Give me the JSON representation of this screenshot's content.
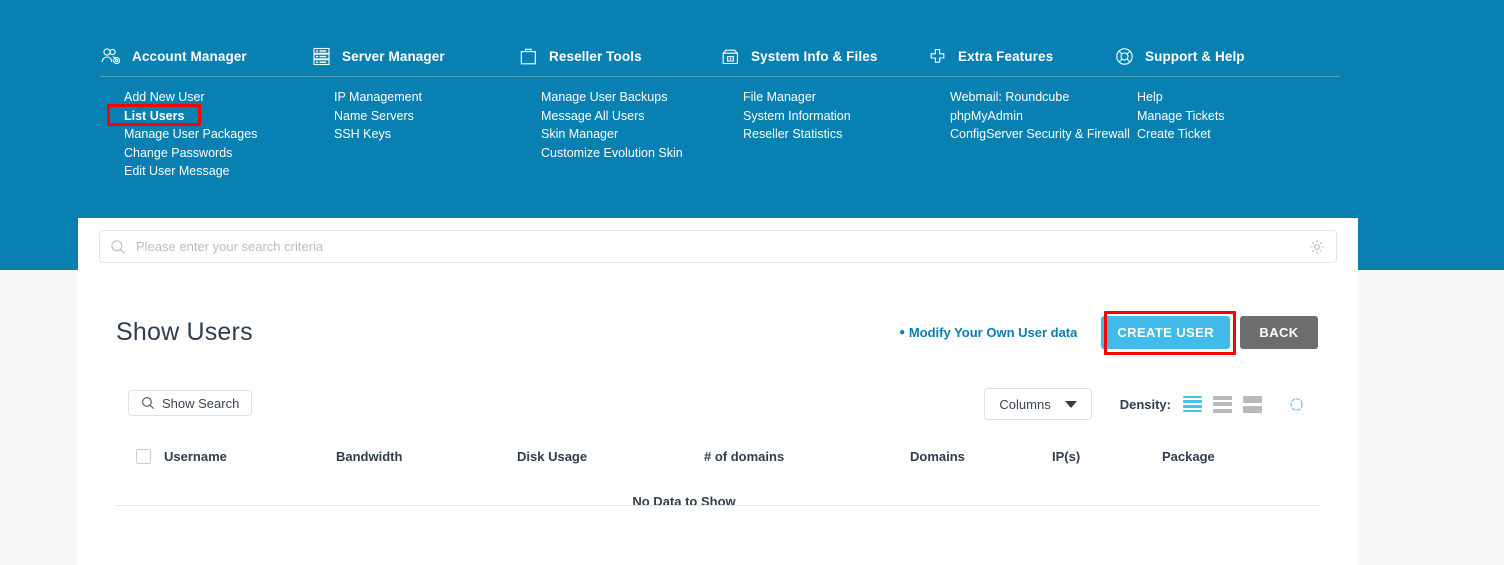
{
  "theme": {
    "header_bg": "#0880b1",
    "page_bg": "#f7f8f8",
    "accent": "#42bbea",
    "link": "#0a7fb0",
    "highlight": "#ff0000",
    "back_button_bg": "#6d6d6d"
  },
  "nav": {
    "columns": [
      {
        "title": "Account Manager",
        "icon": "users-gear-icon",
        "links": [
          {
            "label": "Add New User",
            "highlighted": false
          },
          {
            "label": "List Users",
            "highlighted": true
          },
          {
            "label": "Manage User Packages",
            "highlighted": false
          },
          {
            "label": "Change Passwords",
            "highlighted": false
          },
          {
            "label": "Edit User Message",
            "highlighted": false
          }
        ]
      },
      {
        "title": "Server Manager",
        "icon": "server-rack-icon",
        "links": [
          {
            "label": "IP Management",
            "highlighted": false
          },
          {
            "label": "Name Servers",
            "highlighted": false
          },
          {
            "label": "SSH Keys",
            "highlighted": false
          }
        ]
      },
      {
        "title": "Reseller Tools",
        "icon": "briefcase-icon",
        "links": [
          {
            "label": "Manage User Backups",
            "highlighted": false
          },
          {
            "label": "Message All Users",
            "highlighted": false
          },
          {
            "label": "Skin Manager",
            "highlighted": false
          },
          {
            "label": "Customize Evolution Skin",
            "highlighted": false
          }
        ]
      },
      {
        "title": "System Info & Files",
        "icon": "file-cabinet-icon",
        "links": [
          {
            "label": "File Manager",
            "highlighted": false
          },
          {
            "label": "System Information",
            "highlighted": false
          },
          {
            "label": "Reseller Statistics",
            "highlighted": false
          }
        ]
      },
      {
        "title": "Extra Features",
        "icon": "plus-icon",
        "links": [
          {
            "label": "Webmail: Roundcube",
            "highlighted": false
          },
          {
            "label": "phpMyAdmin",
            "highlighted": false
          },
          {
            "label": "ConfigServer Security & Firewall",
            "highlighted": false
          }
        ]
      },
      {
        "title": "Support & Help",
        "icon": "life-ring-icon",
        "links": [
          {
            "label": "Help",
            "highlighted": false
          },
          {
            "label": "Manage Tickets",
            "highlighted": false
          },
          {
            "label": "Create Ticket",
            "highlighted": false
          }
        ]
      }
    ]
  },
  "search": {
    "placeholder": "Please enter your search criteria",
    "value": "",
    "icon": "search-icon",
    "settings_icon": "gear-icon"
  },
  "page": {
    "title": "Show Users",
    "modify_link": "Modify Your Own User data",
    "create_button": "CREATE USER",
    "back_button": "BACK"
  },
  "toolbar": {
    "show_search": "Show Search",
    "columns": "Columns",
    "density_label": "Density:",
    "density_options": [
      "compact",
      "standard",
      "comfortable"
    ],
    "density_selected": "compact",
    "refresh_icon": "refresh-icon"
  },
  "table": {
    "columns": [
      "Username",
      "Bandwidth",
      "Disk Usage",
      "# of domains",
      "Domains",
      "IP(s)",
      "Package"
    ],
    "rows": [],
    "empty_message": "No Data to Show"
  }
}
